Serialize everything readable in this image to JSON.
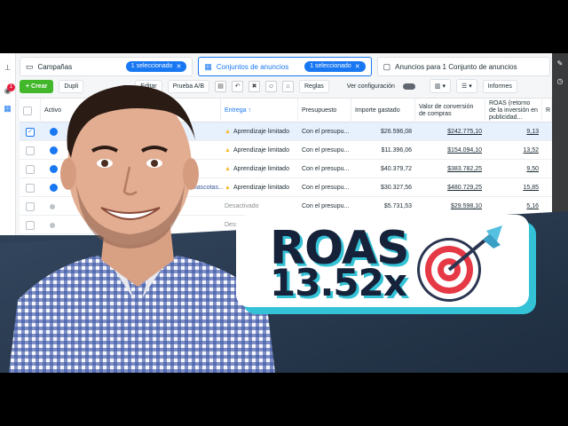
{
  "tabs": {
    "campaigns": {
      "label": "Campañas",
      "pill": "1 seleccionado"
    },
    "adsets": {
      "label": "Conjuntos de anuncios",
      "pill": "1 seleccionado"
    },
    "ads": {
      "label": "Anuncios para 1 Conjunto de anuncios"
    }
  },
  "toolbar": {
    "create": "+ Crear",
    "duplicate": "Dupli",
    "edit": "Editar",
    "ab_test": "Prueba A/B",
    "rules": "Reglas",
    "view_config": "Ver configuración",
    "reports": "Informes"
  },
  "columns": {
    "active": "Activo",
    "delivery": "Entrega ↑",
    "budget": "Presupuesto",
    "spent": "Importe gastado",
    "conv_value": "Valor de conversión de compras",
    "roas": "ROAS (retorno de la inversión en publicidad...",
    "r": "R"
  },
  "rows": [
    {
      "delivery": "Aprendizaje limitado",
      "budget": "Con el presupu...",
      "spent": "$26.596,08",
      "conv": "$242.775,10",
      "roas": "9,13",
      "selected": true,
      "active": true,
      "name": ""
    },
    {
      "delivery": "Aprendizaje limitado",
      "budget": "Con el presupu...",
      "spent": "$11.396,06",
      "conv": "$154.094,10",
      "roas": "13,52",
      "selected": false,
      "active": true,
      "name": ""
    },
    {
      "delivery": "Aprendizaje limitado",
      "budget": "Con el presupu...",
      "spent": "$40.379,72",
      "conv": "$383.782,25",
      "roas": "9,50",
      "selected": false,
      "active": true,
      "name": ""
    },
    {
      "delivery": "Aprendizaje limitado",
      "budget": "Con el presupu...",
      "spent": "$30.327,56",
      "conv": "$480.729,25",
      "roas": "15,85",
      "selected": false,
      "active": true,
      "name": "Mascotas..."
    },
    {
      "delivery": "Desactivado",
      "budget": "Con el presupu...",
      "spent": "$5.731,53",
      "conv": "$29.598,10",
      "roas": "5,16",
      "selected": false,
      "active": false,
      "name": ""
    },
    {
      "delivery": "Desactiv...",
      "budget": "",
      "spent": "",
      "conv": "",
      "roas": "",
      "selected": false,
      "active": false,
      "name": ""
    }
  ],
  "badge": {
    "label": "ROAS",
    "value": "13.52x"
  },
  "colors": {
    "brand_blue": "#1877f2",
    "accent_teal": "#34c2d6",
    "navy": "#16223a",
    "create_green": "#42b72a"
  }
}
